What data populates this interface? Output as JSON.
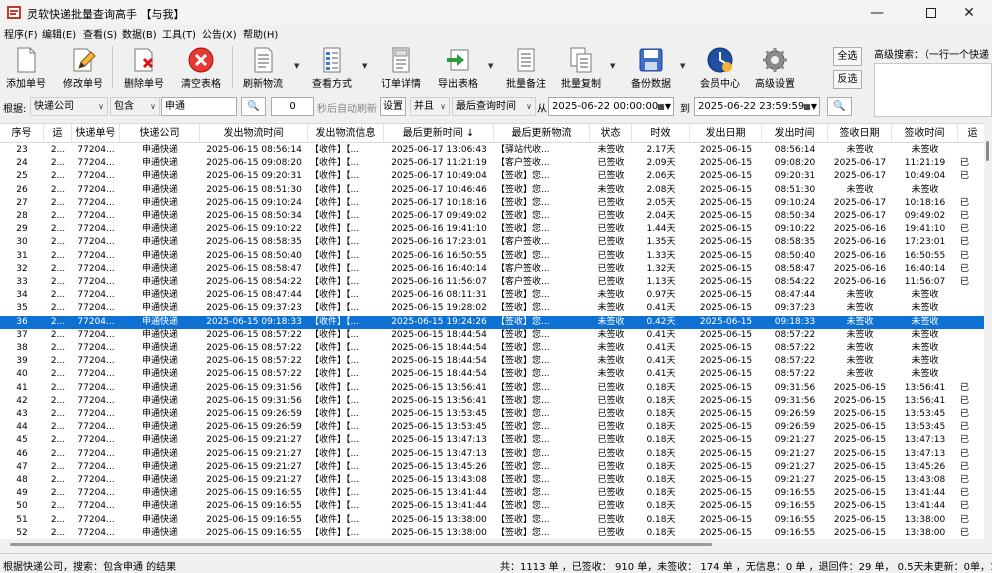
{
  "window": {
    "title": "灵软快递批量查询高手 【与我】"
  },
  "menu": [
    "程序(F)",
    "编辑(E)",
    "查看(S)",
    "数据(B)",
    "工具(T)",
    "公告(X)",
    "帮助(H)"
  ],
  "toolbar": {
    "add": "添加单号",
    "edit": "修改单号",
    "delete": "删除单号",
    "clear": "清空表格",
    "refresh": "刷新物流",
    "view": "查看方式",
    "detail": "订单详情",
    "export": "导出表格",
    "batch_note": "批量备注",
    "batch_copy": "批量复制",
    "backup": "备份数据",
    "member": "会员中心",
    "advanced": "高级设置",
    "select_all": "全选",
    "invert": "反选"
  },
  "advanced_search": {
    "label": "高级搜索：（一行一个快递"
  },
  "filter": {
    "by_label": "根据:",
    "field": "快递公司",
    "op": "包含",
    "keyword": "申通",
    "interval": "0",
    "auto_refresh": "秒后自动刷新",
    "settings": "设置",
    "logic": "并且",
    "time_field": "最后查询时间",
    "from_label": "从",
    "from": "2025-06-22 00:00:00",
    "to_label": "到",
    "to": "2025-06-22 23:59:59"
  },
  "columns": [
    "序号",
    "运",
    "快递单号",
    "快递公司",
    "发出物流时间",
    "发出物流信息",
    "最后更新时间 ↓",
    "最后更新物流",
    "状态",
    "时效",
    "发出日期",
    "发出时间",
    "签收日期",
    "签收时间",
    "运"
  ],
  "rows": [
    [
      "23",
      "2...",
      "77204...",
      "申通快递",
      "2025-06-15 08:56:14",
      "【收件】【...",
      "2025-06-17 13:06:43",
      "【驿站代收...",
      "未签收",
      "2.17天",
      "2025-06-15",
      "08:56:14",
      "未签收",
      "未签收",
      ""
    ],
    [
      "24",
      "2...",
      "77204...",
      "申通快递",
      "2025-06-15 09:08:20",
      "【收件】【...",
      "2025-06-17 11:21:19",
      "【客户签收...",
      "已签收",
      "2.09天",
      "2025-06-15",
      "09:08:20",
      "2025-06-17",
      "11:21:19",
      "已"
    ],
    [
      "25",
      "2...",
      "77204...",
      "申通快递",
      "2025-06-15 09:20:31",
      "【收件】【...",
      "2025-06-17 10:49:04",
      "【签收】您...",
      "已签收",
      "2.06天",
      "2025-06-15",
      "09:20:31",
      "2025-06-17",
      "10:49:04",
      "已"
    ],
    [
      "26",
      "2...",
      "77204...",
      "申通快递",
      "2025-06-15 08:51:30",
      "【收件】【...",
      "2025-06-17 10:46:46",
      "【签收】您...",
      "未签收",
      "2.08天",
      "2025-06-15",
      "08:51:30",
      "未签收",
      "未签收",
      ""
    ],
    [
      "27",
      "2...",
      "77204...",
      "申通快递",
      "2025-06-15 09:10:24",
      "【收件】【...",
      "2025-06-17 10:18:16",
      "【签收】您...",
      "已签收",
      "2.05天",
      "2025-06-15",
      "09:10:24",
      "2025-06-17",
      "10:18:16",
      "已"
    ],
    [
      "28",
      "2...",
      "77204...",
      "申通快递",
      "2025-06-15 08:50:34",
      "【收件】【...",
      "2025-06-17 09:49:02",
      "【签收】您...",
      "已签收",
      "2.04天",
      "2025-06-15",
      "08:50:34",
      "2025-06-17",
      "09:49:02",
      "已"
    ],
    [
      "29",
      "2...",
      "77204...",
      "申通快递",
      "2025-06-15 09:10:22",
      "【收件】【...",
      "2025-06-16 19:41:10",
      "【签收】您...",
      "已签收",
      "1.44天",
      "2025-06-15",
      "09:10:22",
      "2025-06-16",
      "19:41:10",
      "已"
    ],
    [
      "30",
      "2...",
      "77204...",
      "申通快递",
      "2025-06-15 08:58:35",
      "【收件】【...",
      "2025-06-16 17:23:01",
      "【客户签收...",
      "已签收",
      "1.35天",
      "2025-06-15",
      "08:58:35",
      "2025-06-16",
      "17:23:01",
      "已"
    ],
    [
      "31",
      "2...",
      "77204...",
      "申通快递",
      "2025-06-15 08:50:40",
      "【收件】【...",
      "2025-06-16 16:50:55",
      "【签收】您...",
      "已签收",
      "1.33天",
      "2025-06-15",
      "08:50:40",
      "2025-06-16",
      "16:50:55",
      "已"
    ],
    [
      "32",
      "2...",
      "77204...",
      "申通快递",
      "2025-06-15 08:58:47",
      "【收件】【...",
      "2025-06-16 16:40:14",
      "【客户签收...",
      "已签收",
      "1.32天",
      "2025-06-15",
      "08:58:47",
      "2025-06-16",
      "16:40:14",
      "已"
    ],
    [
      "33",
      "2...",
      "77204...",
      "申通快递",
      "2025-06-15 08:54:22",
      "【收件】【...",
      "2025-06-16 11:56:07",
      "【客户签收...",
      "已签收",
      "1.13天",
      "2025-06-15",
      "08:54:22",
      "2025-06-16",
      "11:56:07",
      "已"
    ],
    [
      "34",
      "2...",
      "77204...",
      "申通快递",
      "2025-06-15 08:47:44",
      "【收件】【...",
      "2025-06-16 08:11:31",
      "【签收】您...",
      "未签收",
      "0.97天",
      "2025-06-15",
      "08:47:44",
      "未签收",
      "未签收",
      ""
    ],
    [
      "35",
      "2...",
      "77204...",
      "申通快递",
      "2025-06-15 09:37:23",
      "【收件】【...",
      "2025-06-15 19:28:02",
      "【签收】您...",
      "未签收",
      "0.41天",
      "2025-06-15",
      "09:37:23",
      "未签收",
      "未签收",
      ""
    ],
    [
      "36",
      "2...",
      "77204...",
      "申通快递",
      "2025-06-15 09:18:33",
      "【收件】【...",
      "2025-06-15 19:24:26",
      "【签收】您...",
      "未签收",
      "0.42天",
      "2025-06-15",
      "09:18:33",
      "未签收",
      "未签收",
      ""
    ],
    [
      "37",
      "2...",
      "77204...",
      "申通快递",
      "2025-06-15 08:57:22",
      "【收件】【...",
      "2025-06-15 18:44:54",
      "【签收】您...",
      "未签收",
      "0.41天",
      "2025-06-15",
      "08:57:22",
      "未签收",
      "未签收",
      ""
    ],
    [
      "38",
      "2...",
      "77204...",
      "申通快递",
      "2025-06-15 08:57:22",
      "【收件】【...",
      "2025-06-15 18:44:54",
      "【签收】您...",
      "未签收",
      "0.41天",
      "2025-06-15",
      "08:57:22",
      "未签收",
      "未签收",
      ""
    ],
    [
      "39",
      "2...",
      "77204...",
      "申通快递",
      "2025-06-15 08:57:22",
      "【收件】【...",
      "2025-06-15 18:44:54",
      "【签收】您...",
      "未签收",
      "0.41天",
      "2025-06-15",
      "08:57:22",
      "未签收",
      "未签收",
      ""
    ],
    [
      "40",
      "2...",
      "77204...",
      "申通快递",
      "2025-06-15 08:57:22",
      "【收件】【...",
      "2025-06-15 18:44:54",
      "【签收】您...",
      "未签收",
      "0.41天",
      "2025-06-15",
      "08:57:22",
      "未签收",
      "未签收",
      ""
    ],
    [
      "41",
      "2...",
      "77204...",
      "申通快递",
      "2025-06-15 09:31:56",
      "【收件】【...",
      "2025-06-15 13:56:41",
      "【签收】您...",
      "已签收",
      "0.18天",
      "2025-06-15",
      "09:31:56",
      "2025-06-15",
      "13:56:41",
      "已"
    ],
    [
      "42",
      "2...",
      "77204...",
      "申通快递",
      "2025-06-15 09:31:56",
      "【收件】【...",
      "2025-06-15 13:56:41",
      "【签收】您...",
      "已签收",
      "0.18天",
      "2025-06-15",
      "09:31:56",
      "2025-06-15",
      "13:56:41",
      "已"
    ],
    [
      "43",
      "2...",
      "77204...",
      "申通快递",
      "2025-06-15 09:26:59",
      "【收件】【...",
      "2025-06-15 13:53:45",
      "【签收】您...",
      "已签收",
      "0.18天",
      "2025-06-15",
      "09:26:59",
      "2025-06-15",
      "13:53:45",
      "已"
    ],
    [
      "44",
      "2...",
      "77204...",
      "申通快递",
      "2025-06-15 09:26:59",
      "【收件】【...",
      "2025-06-15 13:53:45",
      "【签收】您...",
      "已签收",
      "0.18天",
      "2025-06-15",
      "09:26:59",
      "2025-06-15",
      "13:53:45",
      "已"
    ],
    [
      "45",
      "2...",
      "77204...",
      "申通快递",
      "2025-06-15 09:21:27",
      "【收件】【...",
      "2025-06-15 13:47:13",
      "【签收】您...",
      "已签收",
      "0.18天",
      "2025-06-15",
      "09:21:27",
      "2025-06-15",
      "13:47:13",
      "已"
    ],
    [
      "46",
      "2...",
      "77204...",
      "申通快递",
      "2025-06-15 09:21:27",
      "【收件】【...",
      "2025-06-15 13:47:13",
      "【签收】您...",
      "已签收",
      "0.18天",
      "2025-06-15",
      "09:21:27",
      "2025-06-15",
      "13:47:13",
      "已"
    ],
    [
      "47",
      "2...",
      "77204...",
      "申通快递",
      "2025-06-15 09:21:27",
      "【收件】【...",
      "2025-06-15 13:45:26",
      "【签收】您...",
      "已签收",
      "0.18天",
      "2025-06-15",
      "09:21:27",
      "2025-06-15",
      "13:45:26",
      "已"
    ],
    [
      "48",
      "2...",
      "77204...",
      "申通快递",
      "2025-06-15 09:21:27",
      "【收件】【...",
      "2025-06-15 13:43:08",
      "【签收】您...",
      "已签收",
      "0.18天",
      "2025-06-15",
      "09:21:27",
      "2025-06-15",
      "13:43:08",
      "已"
    ],
    [
      "49",
      "2...",
      "77204...",
      "申通快递",
      "2025-06-15 09:16:55",
      "【收件】【...",
      "2025-06-15 13:41:44",
      "【签收】您...",
      "已签收",
      "0.18天",
      "2025-06-15",
      "09:16:55",
      "2025-06-15",
      "13:41:44",
      "已"
    ],
    [
      "50",
      "2...",
      "77204...",
      "申通快递",
      "2025-06-15 09:16:55",
      "【收件】【...",
      "2025-06-15 13:41:44",
      "【签收】您...",
      "已签收",
      "0.18天",
      "2025-06-15",
      "09:16:55",
      "2025-06-15",
      "13:41:44",
      "已"
    ],
    [
      "51",
      "2...",
      "77204...",
      "申通快递",
      "2025-06-15 09:16:55",
      "【收件】【...",
      "2025-06-15 13:38:00",
      "【签收】您...",
      "已签收",
      "0.18天",
      "2025-06-15",
      "09:16:55",
      "2025-06-15",
      "13:38:00",
      "已"
    ],
    [
      "52",
      "2...",
      "77204...",
      "申通快递",
      "2025-06-15 09:16:55",
      "【收件】【...",
      "2025-06-15 13:38:00",
      "【签收】您...",
      "已签收",
      "0.18天",
      "2025-06-15",
      "09:16:55",
      "2025-06-15",
      "13:38:00",
      "已"
    ]
  ],
  "selected_row": "36",
  "status": {
    "left": "根据快递公司，搜索：包含申通 的结果",
    "right": "共：1113 单 ，已签收： 910 单，未签收： 174 单 ，无信息：0 单 ，退回件：29 单， 0.5天未更新：0单，1"
  },
  "colors": {
    "selection": "#0f71d4",
    "background": "#f0f0f0"
  }
}
